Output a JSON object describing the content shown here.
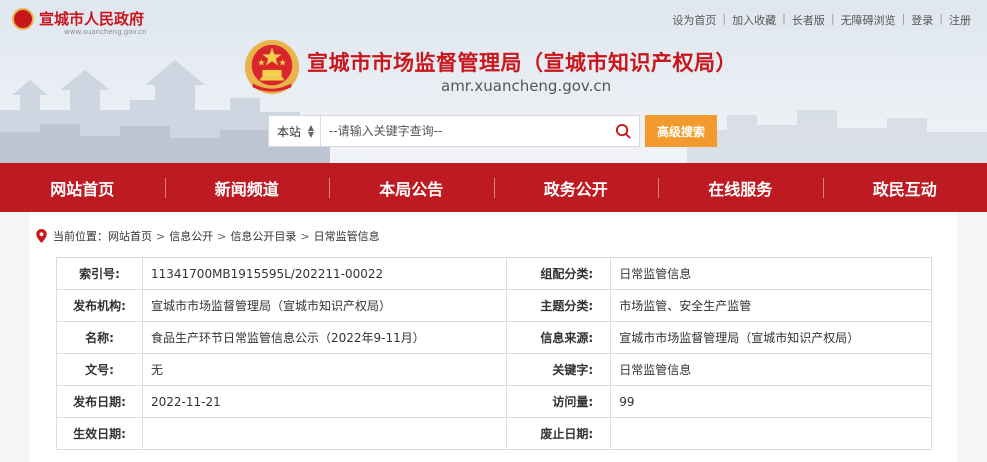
{
  "site": {
    "title": "宣城市人民政府",
    "domain": "www.xuancheng.gov.cn"
  },
  "toplinks": [
    "设为首页",
    "加入收藏",
    "长者版",
    "无障碍浏览",
    "登录",
    "注册"
  ],
  "header": {
    "title": "宣城市市场监督管理局（宣城市知识产权局）",
    "domain": "amr.xuancheng.gov.cn"
  },
  "search": {
    "scope": "本站",
    "placeholder": "--请输入关键字查询--",
    "advanced_label": "高级搜索"
  },
  "nav": [
    "网站首页",
    "新闻频道",
    "本局公告",
    "政务公开",
    "在线服务",
    "政民互动"
  ],
  "breadcrumb": {
    "prefix": "当前位置：",
    "items": [
      "网站首页",
      "信息公开",
      "信息公开目录",
      "日常监管信息"
    ]
  },
  "info_table": {
    "rows": [
      {
        "label1": "索引号:",
        "value1": "11341700MB1915595L/202211-00022",
        "label2": "组配分类:",
        "value2": "日常监管信息"
      },
      {
        "label1": "发布机构:",
        "value1": "宣城市市场监督管理局（宣城市知识产权局）",
        "label2": "主题分类:",
        "value2": "市场监管、安全生产监管"
      },
      {
        "label1": "名称:",
        "value1": "食品生产环节日常监管信息公示（2022年9-11月）",
        "label2": "信息来源:",
        "value2": "宣城市市场监督管理局（宣城市知识产权局）"
      },
      {
        "label1": "文号:",
        "value1": "无",
        "label2": "关键字:",
        "value2": "日常监管信息"
      },
      {
        "label1": "发布日期:",
        "value1": "2022-11-21",
        "label2": "访问量:",
        "value2": "99"
      },
      {
        "label1": "生效日期:",
        "value1": "",
        "label2": "废止日期:",
        "value2": ""
      }
    ]
  },
  "colors": {
    "brand_red": "#bd1a22",
    "title_red": "#c8161d",
    "accent_orange": "#f39a2e"
  },
  "icons": [
    "national-emblem-icon",
    "search-icon",
    "location-pin-icon",
    "sort-arrows-icon"
  ]
}
